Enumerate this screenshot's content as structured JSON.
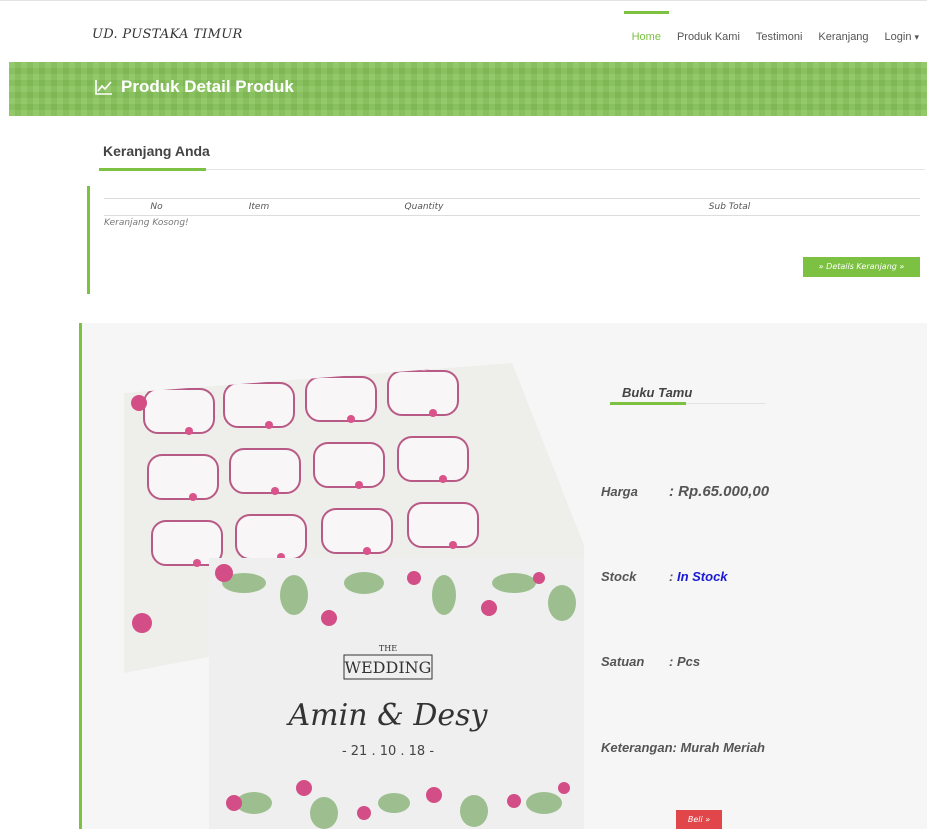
{
  "navbar": {
    "brand": "UD. PUSTAKA TIMUR",
    "items": [
      {
        "label": "Home",
        "active": true
      },
      {
        "label": "Produk Kami",
        "active": false
      },
      {
        "label": "Testimoni",
        "active": false
      },
      {
        "label": "Keranjang",
        "active": false
      },
      {
        "label": "Login",
        "active": false
      }
    ],
    "login_caret": "▾"
  },
  "banner": {
    "icon": "chart-line-icon",
    "title": "Produk Detail Produk",
    "color": "#86c35a"
  },
  "cart": {
    "heading": "Keranjang Anda",
    "columns": [
      "No",
      "Item",
      "Quantity",
      "Sub Total"
    ],
    "empty_message": "Keranjang Kosong!",
    "details_button": "» Details Keranjang »"
  },
  "product": {
    "image_text": {
      "the": "THE",
      "wedding": "WEDDING",
      "names": "Amin & Desy",
      "date": "- 21 . 10 . 18 -"
    },
    "title": "Buku Tamu",
    "harga_label": "Harga",
    "harga_value": ": Rp.65.000,00",
    "stock_label": "Stock",
    "stock_sep": ":",
    "stock_value": "In Stock",
    "satuan_label": "Satuan",
    "satuan_value": ": Pcs",
    "keterangan_label": "Keterangan",
    "keterangan_value": ": Murah Meriah",
    "buy_button": "Beli »"
  },
  "colors": {
    "accent": "#7cc142",
    "stock": "#1a1ad6",
    "buy": "#e0464a"
  }
}
